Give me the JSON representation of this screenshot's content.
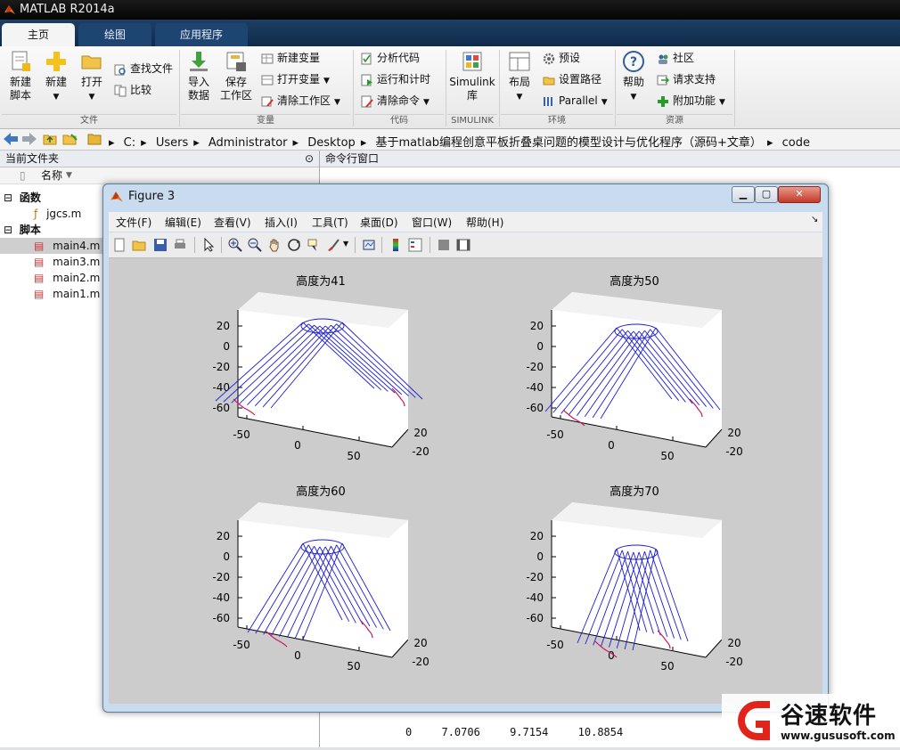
{
  "app": {
    "title": "MATLAB R2014a"
  },
  "tabs": [
    "主页",
    "绘图",
    "应用程序"
  ],
  "ribbon": {
    "new_script": "新建\n脚本",
    "new": "新建",
    "open": "打开",
    "find_files": "查找文件",
    "compare": "比较",
    "import_data": "导入\n数据",
    "save_workspace": "保存\n工作区",
    "new_variable": "新建变量",
    "open_variable": "打开变量",
    "clear_workspace": "清除工作区",
    "analyze_code": "分析代码",
    "run_and_time": "运行和计时",
    "clear_commands": "清除命令",
    "simulink": "Simulink\n库",
    "layout": "布局",
    "preferences": "预设",
    "set_path": "设置路径",
    "parallel": "Parallel",
    "help": "帮助",
    "community": "社区",
    "request_support": "请求支持",
    "add_ons": "附加功能",
    "groups": [
      "文件",
      "变量",
      "代码",
      "SIMULINK",
      "环境",
      "资源"
    ]
  },
  "address": {
    "crumbs": [
      "C:",
      "Users",
      "Administrator",
      "Desktop",
      "基于matlab编程创意平板折叠桌问题的模型设计与优化程序（源码+文章）",
      "code"
    ]
  },
  "left_panel": {
    "title": "当前文件夹",
    "column": "名称",
    "groups": [
      {
        "label": "函数",
        "files": [
          "jgcs.m"
        ]
      },
      {
        "label": "脚本",
        "files": [
          "main4.m",
          "main3.m",
          "main2.m",
          "main1.m"
        ]
      }
    ]
  },
  "right_panel": {
    "title": "命令行窗口"
  },
  "figure": {
    "title": "Figure 3",
    "menu": [
      "文件(F)",
      "编辑(E)",
      "查看(V)",
      "插入(I)",
      "工具(T)",
      "桌面(D)",
      "窗口(W)",
      "帮助(H)"
    ]
  },
  "chart_data": [
    {
      "type": "line",
      "title": "高度为41",
      "z_ticks": [
        "20",
        "0",
        "-20",
        "-40",
        "-60"
      ],
      "x_ticks": [
        "-50",
        "0",
        "50"
      ],
      "y_ticks": [
        "20",
        "-20"
      ],
      "colors": [
        "#1b1bd6",
        "#d01060"
      ]
    },
    {
      "type": "line",
      "title": "高度为50",
      "z_ticks": [
        "20",
        "0",
        "-20",
        "-40",
        "-60"
      ],
      "x_ticks": [
        "-50",
        "0",
        "50"
      ],
      "y_ticks": [
        "20",
        "-20"
      ],
      "colors": [
        "#1b1bd6",
        "#d01060"
      ]
    },
    {
      "type": "line",
      "title": "高度为60",
      "z_ticks": [
        "20",
        "0",
        "-20",
        "-40",
        "-60"
      ],
      "x_ticks": [
        "-50",
        "0",
        "50"
      ],
      "y_ticks": [
        "20",
        "-20"
      ],
      "colors": [
        "#1b1bd6",
        "#d01060"
      ]
    },
    {
      "type": "line",
      "title": "高度为70",
      "z_ticks": [
        "20",
        "0",
        "-20",
        "-40",
        "-60"
      ],
      "x_ticks": [
        "-50",
        "0",
        "50"
      ],
      "y_ticks": [
        "20",
        "-20"
      ],
      "colors": [
        "#1b1bd6",
        "#d01060"
      ]
    }
  ],
  "command_output": [
    "0",
    "7.0706",
    "9.7154",
    "10.8854"
  ],
  "watermark": {
    "brand": "谷速软件",
    "url": "www.gususoft.com"
  }
}
